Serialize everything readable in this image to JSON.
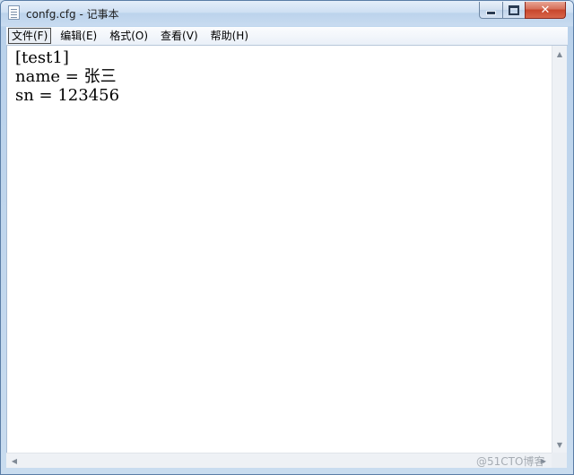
{
  "window": {
    "title": "confg.cfg - 记事本",
    "close_glyph": "✕"
  },
  "menubar": {
    "items": [
      "文件(F)",
      "编辑(E)",
      "格式(O)",
      "查看(V)",
      "帮助(H)"
    ]
  },
  "editor": {
    "lines": [
      "[test1]",
      "name = 张三",
      "sn = 123456"
    ]
  },
  "scrollbars": {
    "up": "▲",
    "down": "▼",
    "left": "◀",
    "right": "▶"
  },
  "watermark": {
    "text": "@51CTO博客"
  }
}
